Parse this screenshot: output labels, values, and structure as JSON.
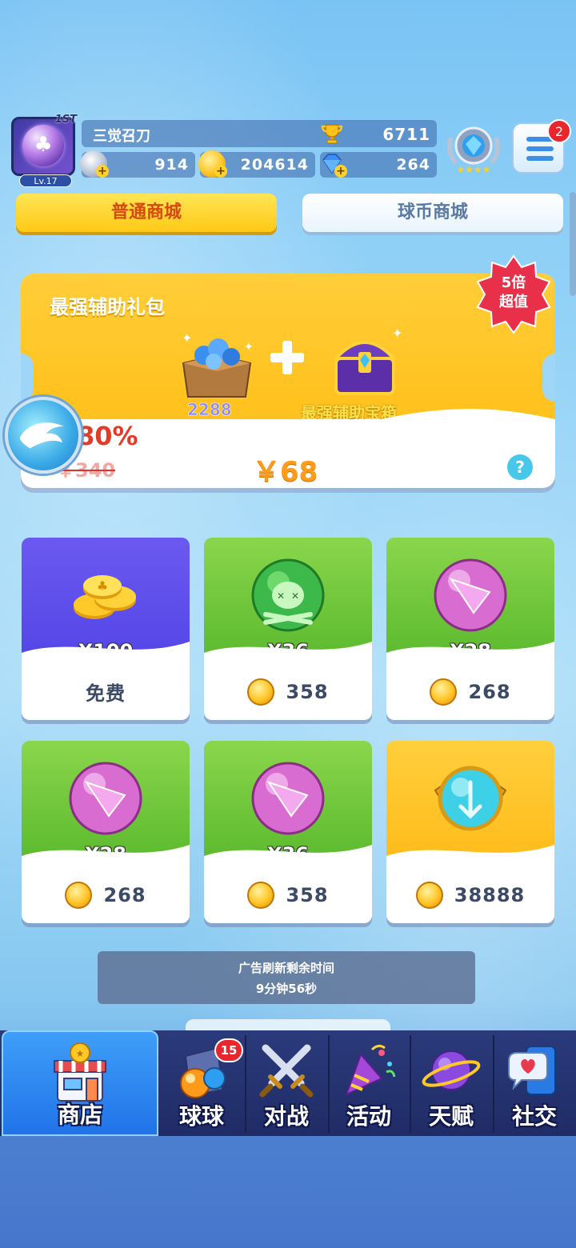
{
  "player": {
    "name": "三觉召刀",
    "level": "Lv.17",
    "rank_tag": "1ST",
    "trophies": "6711",
    "silver": "914",
    "coins": "204614",
    "gems": "264"
  },
  "menu": {
    "badge": "2"
  },
  "tabs": [
    {
      "label": "普通商城",
      "active": true
    },
    {
      "label": "球币商城",
      "active": false
    }
  ],
  "gift": {
    "title": "最强辅助礼包",
    "gem_amount": "2288",
    "chest_name": "最强辅助宝箱",
    "discount": "80%",
    "original_price": "￥340",
    "price": "￥68",
    "help": "?",
    "badge_line1": "5倍",
    "badge_line2": "超值"
  },
  "items": [
    {
      "qty": "X100",
      "cost": "免费",
      "theme": "purple",
      "art": "gold-coins-icon",
      "free": true
    },
    {
      "qty": "X36",
      "cost": "358",
      "theme": "green",
      "art": "green-skull-ball-icon"
    },
    {
      "qty": "X28",
      "cost": "268",
      "theme": "green",
      "art": "pink-arrow-ball-icon"
    },
    {
      "qty": "X28",
      "cost": "268",
      "theme": "green",
      "art": "pink-arrow-ball-icon"
    },
    {
      "qty": "X36",
      "cost": "358",
      "theme": "green",
      "art": "pink-arrow-ball-icon"
    },
    {
      "qty": "",
      "cost": "38888",
      "theme": "gold",
      "art": "cyan-winged-ball-icon"
    }
  ],
  "timer": {
    "line1": "广告刷新剩余时间",
    "line2": "9分钟56秒"
  },
  "nav": [
    {
      "label": "商店",
      "active": true,
      "icon": "shop-icon"
    },
    {
      "label": "球球",
      "badge": "15",
      "icon": "balls-icon"
    },
    {
      "label": "对战",
      "icon": "crossed-swords-icon"
    },
    {
      "label": "活动",
      "icon": "party-popper-icon"
    },
    {
      "label": "天赋",
      "icon": "planet-icon"
    },
    {
      "label": "社交",
      "icon": "chat-phone-icon"
    }
  ],
  "colors": {
    "tab_active": "#ffd530",
    "card_green": "#6ac83a",
    "card_purple": "#5d4eea",
    "card_gold": "#ffc527",
    "price_orange": "#ff9c1a",
    "nav_bg": "#26357a",
    "nav_active": "#2f88f0"
  }
}
